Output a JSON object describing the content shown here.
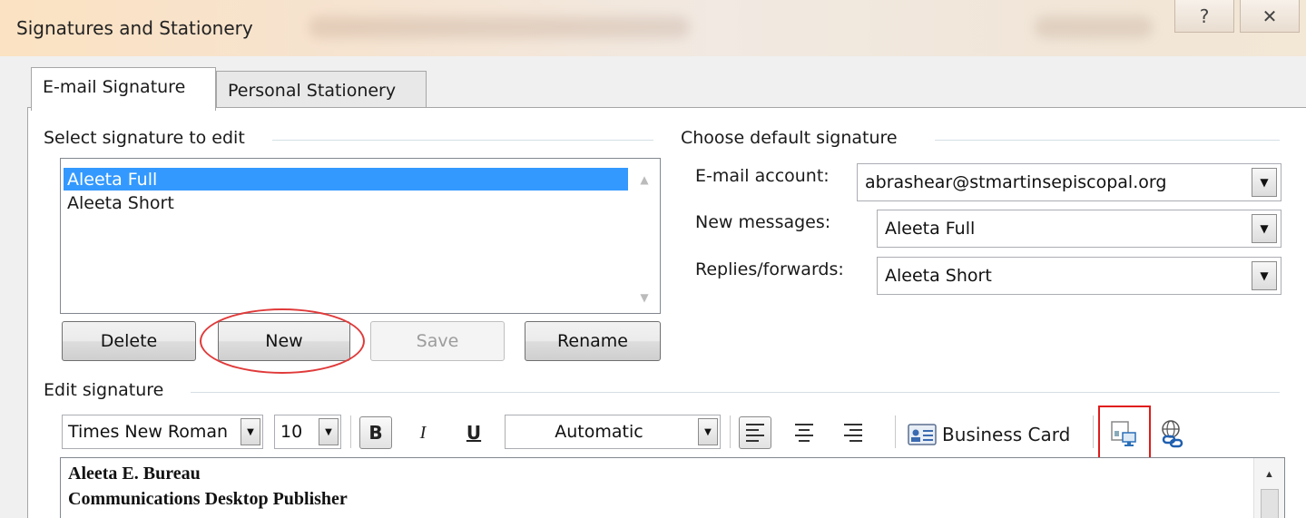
{
  "window": {
    "title": "Signatures and Stationery",
    "help_glyph": "?",
    "close_glyph": "✕"
  },
  "tabs": [
    {
      "label": "E-mail Signature",
      "accel": "E",
      "active": true
    },
    {
      "label": "Personal Stationery",
      "accel": "P",
      "active": false
    }
  ],
  "select_section": {
    "label": "Select signature to edit",
    "items": [
      "Aleeta Full",
      "Aleeta Short"
    ],
    "selected_index": 0
  },
  "buttons": {
    "delete": "Delete",
    "new": "New",
    "save": "Save",
    "rename": "Rename"
  },
  "default_section": {
    "label": "Choose default signature",
    "email_account_label": "E-mail account:",
    "email_account_value": "abrashear@stmartinsepiscopal.org",
    "new_messages_label": "New messages:",
    "new_messages_value": "Aleeta Full",
    "replies_label": "Replies/forwards:",
    "replies_value": "Aleeta Short"
  },
  "edit_section": {
    "label": "Edit signature",
    "font_name": "Times New Roman",
    "font_size": "10",
    "bold": "B",
    "italic": "I",
    "underline": "U",
    "color": "Automatic",
    "business_card": "Business Card",
    "content_lines": [
      "Aleeta E. Bureau",
      "Communications Desktop Publisher"
    ]
  },
  "annotations": {
    "highlight_color": "#e03a3a"
  }
}
